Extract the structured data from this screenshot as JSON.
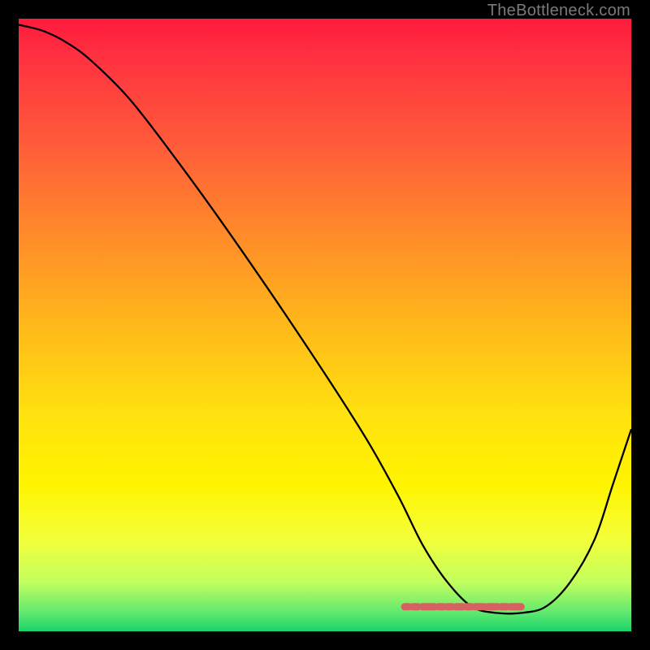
{
  "attribution": "TheBottleneck.com",
  "colors": {
    "background_black": "#000000",
    "gradient_stops": [
      "#ff1a3d",
      "#ff3040",
      "#ff5a3a",
      "#ff8a2a",
      "#ffb81a",
      "#ffe010",
      "#fff400",
      "#f3ff3a",
      "#c2ff5e",
      "#5fe86f",
      "#19d36a"
    ],
    "curve": "#000000",
    "dot_strip": "#d6625f",
    "attribution_text": "#7a7a7a"
  },
  "chart_data": {
    "type": "line",
    "title": "",
    "xlabel": "",
    "ylabel": "",
    "xlim": [
      0,
      100
    ],
    "ylim": [
      0,
      100
    ],
    "note": "No axes, ticks, or numeric labels are visible in the image; x and y are normalized 0–100 estimated from pixel positions. y=0 is the bottom (green) edge, y=100 is the top (red) edge.",
    "series": [
      {
        "name": "bottleneck-curve",
        "x": [
          0,
          4,
          8,
          12,
          18,
          25,
          33,
          42,
          50,
          57,
          62,
          66,
          70,
          74,
          78,
          82,
          86,
          90,
          94,
          97,
          100
        ],
        "y": [
          99,
          98,
          96,
          93,
          87,
          78,
          67,
          54,
          42,
          31,
          22,
          14,
          8,
          4,
          3,
          3,
          4,
          8,
          15,
          24,
          33
        ]
      }
    ],
    "highlight_region": {
      "name": "flat-bottom-dots",
      "x": [
        63,
        82
      ],
      "y": [
        4,
        4
      ],
      "style": "salmon-dotted"
    }
  }
}
